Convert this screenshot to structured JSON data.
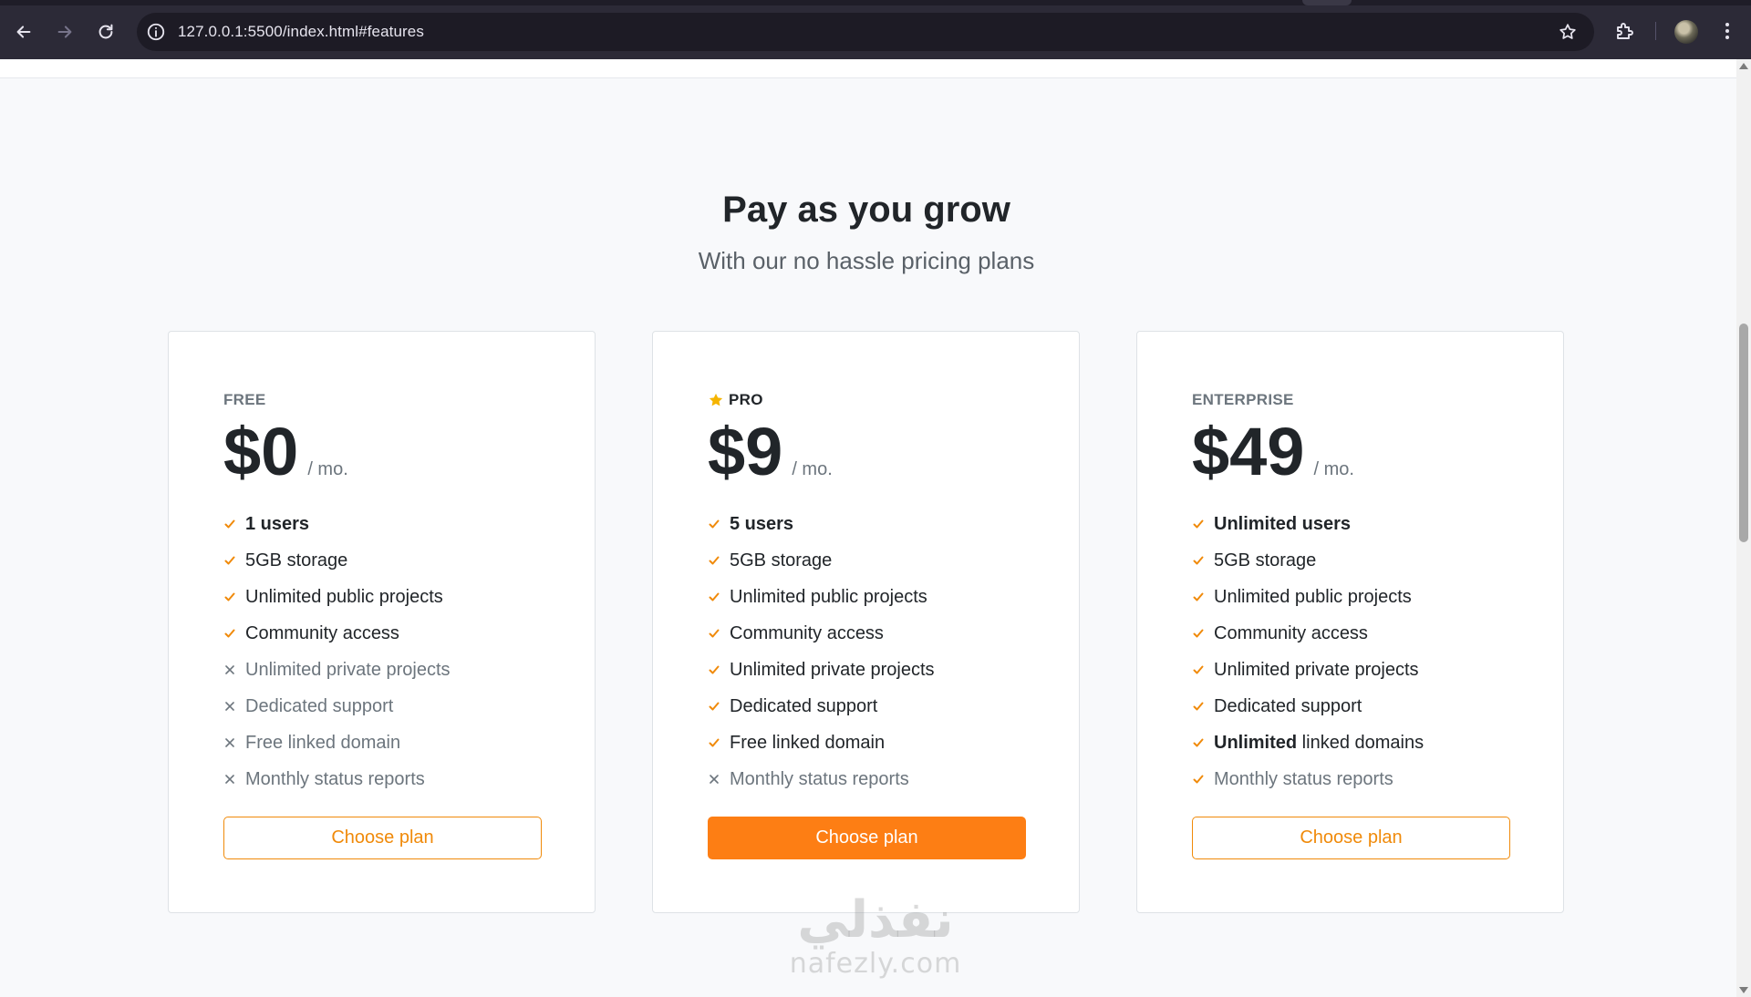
{
  "browser": {
    "url": "127.0.0.1:5500/index.html#features",
    "icons": [
      "back-icon",
      "forward-icon",
      "reload-icon",
      "info-icon",
      "bookmark-star-icon",
      "extensions-icon",
      "avatar",
      "menu-kebab-icon"
    ]
  },
  "section": {
    "title": "Pay as you grow",
    "subtitle": "With our no hassle pricing plans"
  },
  "colors": {
    "accent": "#fd7e14",
    "check": "#f08a0a",
    "star": "#f5b400",
    "text": "#212529",
    "muted": "#6c757d"
  },
  "plans": [
    {
      "tier": "FREE",
      "price": "$0",
      "per": "/ mo.",
      "button": "Choose plan",
      "features": [
        {
          "bold": "1 users",
          "rest": "",
          "included": true
        },
        {
          "bold": "",
          "rest": "5GB storage",
          "included": true
        },
        {
          "bold": "",
          "rest": "Unlimited public projects",
          "included": true
        },
        {
          "bold": "",
          "rest": "Community access",
          "included": true
        },
        {
          "bold": "",
          "rest": "Unlimited private projects",
          "included": false
        },
        {
          "bold": "",
          "rest": "Dedicated support",
          "included": false
        },
        {
          "bold": "",
          "rest": "Free linked domain",
          "included": false
        },
        {
          "bold": "",
          "rest": "Monthly status reports",
          "included": false
        }
      ]
    },
    {
      "tier": "PRO",
      "price": "$9",
      "per": "/ mo.",
      "button": "Choose plan",
      "features": [
        {
          "bold": "5 users",
          "rest": "",
          "included": true
        },
        {
          "bold": "",
          "rest": "5GB storage",
          "included": true
        },
        {
          "bold": "",
          "rest": "Unlimited public projects",
          "included": true
        },
        {
          "bold": "",
          "rest": "Community access",
          "included": true
        },
        {
          "bold": "",
          "rest": "Unlimited private projects",
          "included": true
        },
        {
          "bold": "",
          "rest": "Dedicated support",
          "included": true
        },
        {
          "bold": "",
          "rest": "Free linked domain",
          "included": true
        },
        {
          "bold": "",
          "rest": "Monthly status reports",
          "included": false
        }
      ]
    },
    {
      "tier": "ENTERPRISE",
      "price": "$49",
      "per": "/ mo.",
      "button": "Choose plan",
      "features": [
        {
          "bold": "Unlimited users",
          "rest": "",
          "included": true
        },
        {
          "bold": "",
          "rest": "5GB storage",
          "included": true
        },
        {
          "bold": "",
          "rest": "Unlimited public projects",
          "included": true
        },
        {
          "bold": "",
          "rest": "Community access",
          "included": true
        },
        {
          "bold": "",
          "rest": "Unlimited private projects",
          "included": true
        },
        {
          "bold": "",
          "rest": "Dedicated support",
          "included": true
        },
        {
          "bold": "Unlimited",
          "rest": " linked domains",
          "included": true
        },
        {
          "bold": "",
          "rest": "Monthly status reports",
          "included": true
        }
      ]
    }
  ],
  "watermark": {
    "arabic": "نفذلي",
    "latin": "nafezly.com"
  }
}
